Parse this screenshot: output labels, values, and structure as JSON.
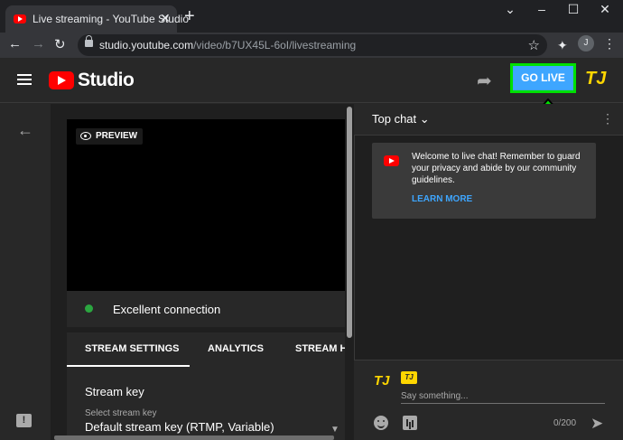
{
  "browser": {
    "tab_title": "Live streaming - YouTube Studio",
    "tab_close": "✕",
    "new_tab": "+",
    "url_host": "studio.youtube.com",
    "url_path": "/video/b7UX45L-6oI/livestreaming",
    "profile_initial": "J",
    "window_controls": {
      "chevron": "⌄",
      "minimize": "–",
      "maximize": "☐",
      "close": "✕"
    }
  },
  "header": {
    "studio_label": "Studio",
    "go_live_label": "GO LIVE",
    "channel_initials": "TJ"
  },
  "preview": {
    "badge_label": "PREVIEW",
    "connection_status": "Excellent connection",
    "status_color": "#2ba640"
  },
  "tabs": [
    {
      "label": "STREAM SETTINGS",
      "active": true
    },
    {
      "label": "ANALYTICS",
      "active": false
    },
    {
      "label": "STREAM H",
      "active": false
    }
  ],
  "stream_settings": {
    "section_title": "Stream key",
    "select_label": "Select stream key",
    "select_value": "Default stream key (RTMP, Variable)"
  },
  "chat": {
    "mode_label": "Top chat",
    "welcome_message": "Welcome to live chat! Remember to guard your privacy and abide by our community guidelines.",
    "learn_more": "LEARN MORE",
    "user_initials": "TJ",
    "input_placeholder": "Say something...",
    "char_count": "0/200"
  },
  "colors": {
    "accent": "#3ea6ff",
    "brand_red": "#ff0000",
    "highlight_green": "#00e000",
    "avatar_yellow": "#ffd600"
  }
}
